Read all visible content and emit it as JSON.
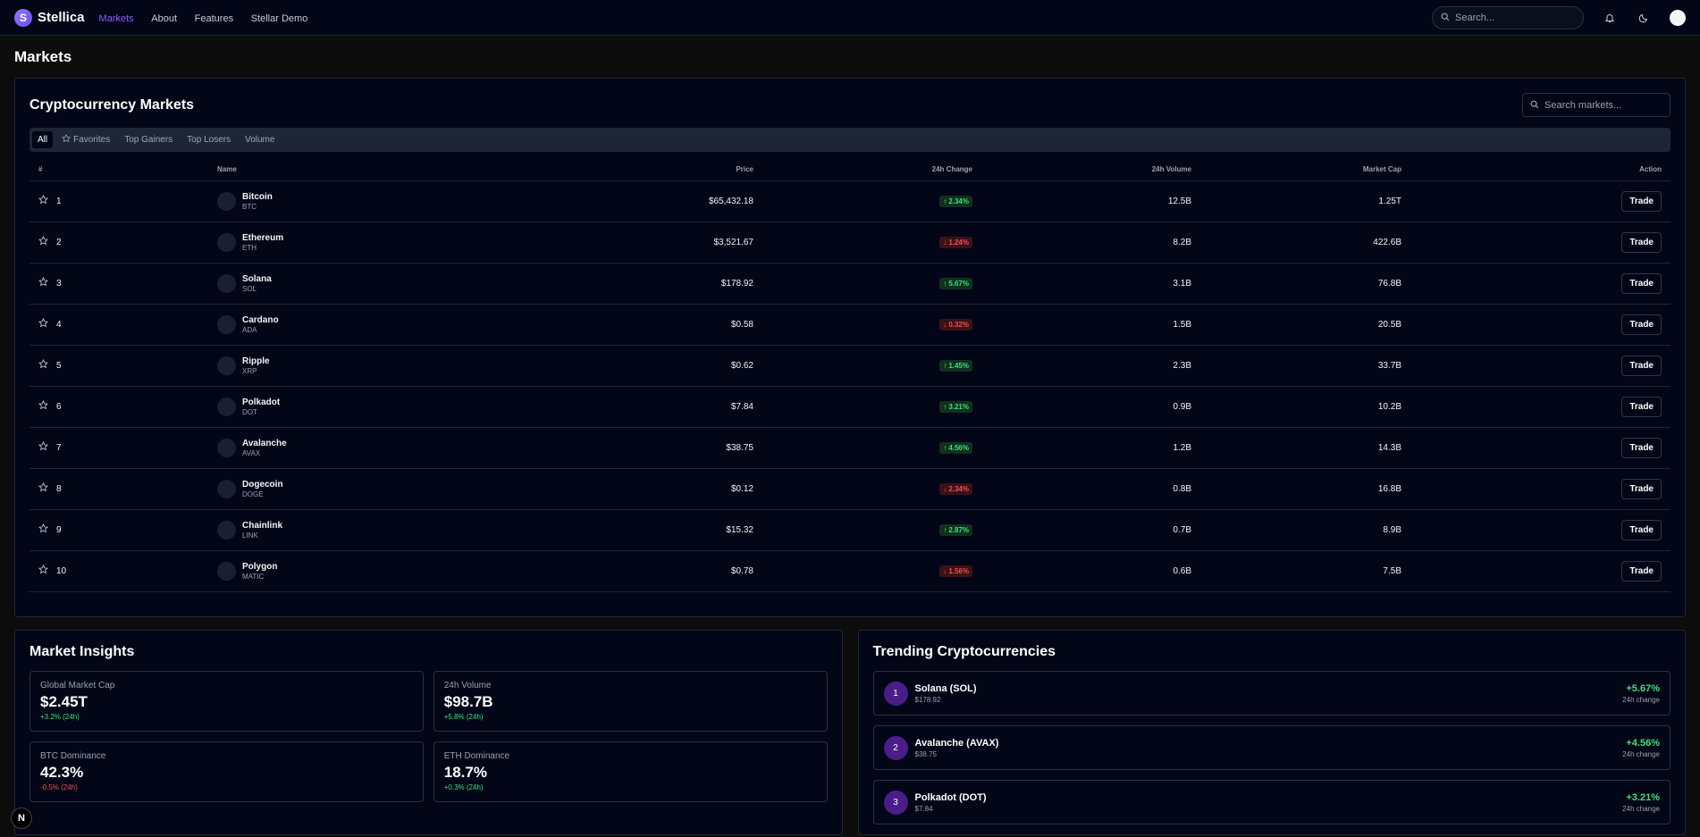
{
  "app": {
    "logo_letter": "S",
    "name": "Stellica"
  },
  "nav": [
    {
      "label": "Markets"
    },
    {
      "label": "About"
    },
    {
      "label": "Features"
    },
    {
      "label": "Stellar Demo"
    }
  ],
  "header": {
    "search_placeholder": "Search..."
  },
  "page": {
    "title": "Markets"
  },
  "markets": {
    "title": "Cryptocurrency Markets",
    "search_placeholder": "Search markets...",
    "tabs": [
      {
        "label": "All"
      },
      {
        "label": "Favorites"
      },
      {
        "label": "Top Gainers"
      },
      {
        "label": "Top Losers"
      },
      {
        "label": "Volume"
      }
    ],
    "columns": {
      "rank": "#",
      "name": "Name",
      "price": "Price",
      "change": "24h Change",
      "volume": "24h Volume",
      "cap": "Market Cap",
      "action": "Action"
    },
    "rows": [
      {
        "rank": "1",
        "name": "Bitcoin",
        "symbol": "BTC",
        "price": "$65,432.18",
        "change": "2.34%",
        "dir": "up",
        "volume": "12.5B",
        "cap": "1.25T",
        "action": "Trade"
      },
      {
        "rank": "2",
        "name": "Ethereum",
        "symbol": "ETH",
        "price": "$3,521.67",
        "change": "1.24%",
        "dir": "down",
        "volume": "8.2B",
        "cap": "422.6B",
        "action": "Trade"
      },
      {
        "rank": "3",
        "name": "Solana",
        "symbol": "SOL",
        "price": "$178.92",
        "change": "5.67%",
        "dir": "up",
        "volume": "3.1B",
        "cap": "76.8B",
        "action": "Trade"
      },
      {
        "rank": "4",
        "name": "Cardano",
        "symbol": "ADA",
        "price": "$0.58",
        "change": "0.32%",
        "dir": "down",
        "volume": "1.5B",
        "cap": "20.5B",
        "action": "Trade"
      },
      {
        "rank": "5",
        "name": "Ripple",
        "symbol": "XRP",
        "price": "$0.62",
        "change": "1.45%",
        "dir": "up",
        "volume": "2.3B",
        "cap": "33.7B",
        "action": "Trade"
      },
      {
        "rank": "6",
        "name": "Polkadot",
        "symbol": "DOT",
        "price": "$7.84",
        "change": "3.21%",
        "dir": "up",
        "volume": "0.9B",
        "cap": "10.2B",
        "action": "Trade"
      },
      {
        "rank": "7",
        "name": "Avalanche",
        "symbol": "AVAX",
        "price": "$38.75",
        "change": "4.56%",
        "dir": "up",
        "volume": "1.2B",
        "cap": "14.3B",
        "action": "Trade"
      },
      {
        "rank": "8",
        "name": "Dogecoin",
        "symbol": "DOGE",
        "price": "$0.12",
        "change": "2.34%",
        "dir": "down",
        "volume": "0.8B",
        "cap": "16.8B",
        "action": "Trade"
      },
      {
        "rank": "9",
        "name": "Chainlink",
        "symbol": "LINK",
        "price": "$15.32",
        "change": "2.87%",
        "dir": "up",
        "volume": "0.7B",
        "cap": "8.9B",
        "action": "Trade"
      },
      {
        "rank": "10",
        "name": "Polygon",
        "symbol": "MATIC",
        "price": "$0.78",
        "change": "1.56%",
        "dir": "down",
        "volume": "0.6B",
        "cap": "7.5B",
        "action": "Trade"
      }
    ]
  },
  "insights": {
    "title": "Market Insights",
    "items": [
      {
        "label": "Global Market Cap",
        "value": "$2.45T",
        "delta": "+3.2% (24h)",
        "dir": "up"
      },
      {
        "label": "24h Volume",
        "value": "$98.7B",
        "delta": "+5.8% (24h)",
        "dir": "up"
      },
      {
        "label": "BTC Dominance",
        "value": "42.3%",
        "delta": "-0.5% (24h)",
        "dir": "down"
      },
      {
        "label": "ETH Dominance",
        "value": "18.7%",
        "delta": "+0.3% (24h)",
        "dir": "up"
      }
    ]
  },
  "trending": {
    "title": "Trending Cryptocurrencies",
    "items": [
      {
        "rank": "1",
        "name": "Solana (SOL)",
        "price": "$178.92",
        "change": "+5.67%",
        "sub": "24h change"
      },
      {
        "rank": "2",
        "name": "Avalanche (AVAX)",
        "price": "$38.75",
        "change": "+4.56%",
        "sub": "24h change"
      },
      {
        "rank": "3",
        "name": "Polkadot (DOT)",
        "price": "$7.84",
        "change": "+3.21%",
        "sub": "24h change"
      }
    ]
  },
  "devtools": {
    "label": "N"
  },
  "colors": {
    "accent": "#8b5cf6",
    "up": "#3ee07b",
    "down": "#f05252",
    "background": "#020617"
  },
  "icons": [
    "search-icon",
    "bell-icon",
    "moon-icon",
    "star-icon",
    "arrow-up-icon",
    "arrow-down-icon"
  ]
}
